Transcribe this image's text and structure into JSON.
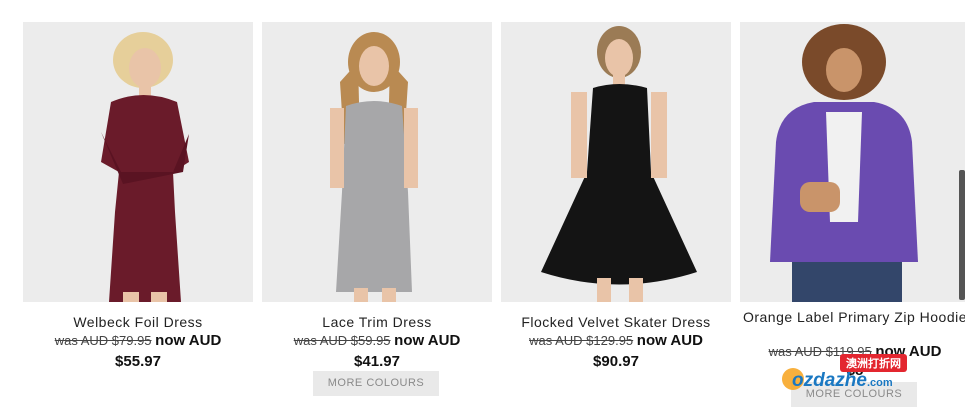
{
  "products": [
    {
      "name": "Welbeck Foil Dress",
      "was_price": "was AUD $79.95",
      "now_label": "now AUD",
      "sale_price": "$55.97",
      "colors": {
        "background": "#ececec",
        "garment": "#6a1b2a",
        "hair": "#e6cf9a",
        "skin": "#e9c4a8"
      }
    },
    {
      "name": "Lace Trim Dress",
      "was_price": "was AUD $59.95",
      "now_label": "now AUD",
      "sale_price": "$41.97",
      "more_colours": "MORE COLOURS",
      "colors": {
        "background": "#ececec",
        "garment": "#a7a7a9",
        "hair": "#b98a52",
        "skin": "#e9c4a8"
      }
    },
    {
      "name": "Flocked Velvet Skater Dress",
      "was_price": "was AUD $129.95",
      "now_label": "now AUD",
      "sale_price": "$90.97",
      "colors": {
        "background": "#ececec",
        "garment": "#141414",
        "hair": "#9b7b55",
        "skin": "#e9c4a8"
      }
    },
    {
      "name": "Orange Label Primary Zip Hoodie",
      "was_price": "was AUD $119.95",
      "now_label": "now AUD",
      "sale_price": "$8",
      "more_colours": "MORE COLOURS",
      "colors": {
        "background": "#ececec",
        "garment": "#6a4bb0",
        "hair": "#7a4a2a",
        "skin": "#c9946a"
      }
    }
  ],
  "watermark": {
    "logo_text": "ozdazhe",
    "logo_suffix": ".com",
    "cn_text": "澳洲打折网"
  },
  "icons": {
    "scrollbar": "scrollbar-thumb"
  }
}
